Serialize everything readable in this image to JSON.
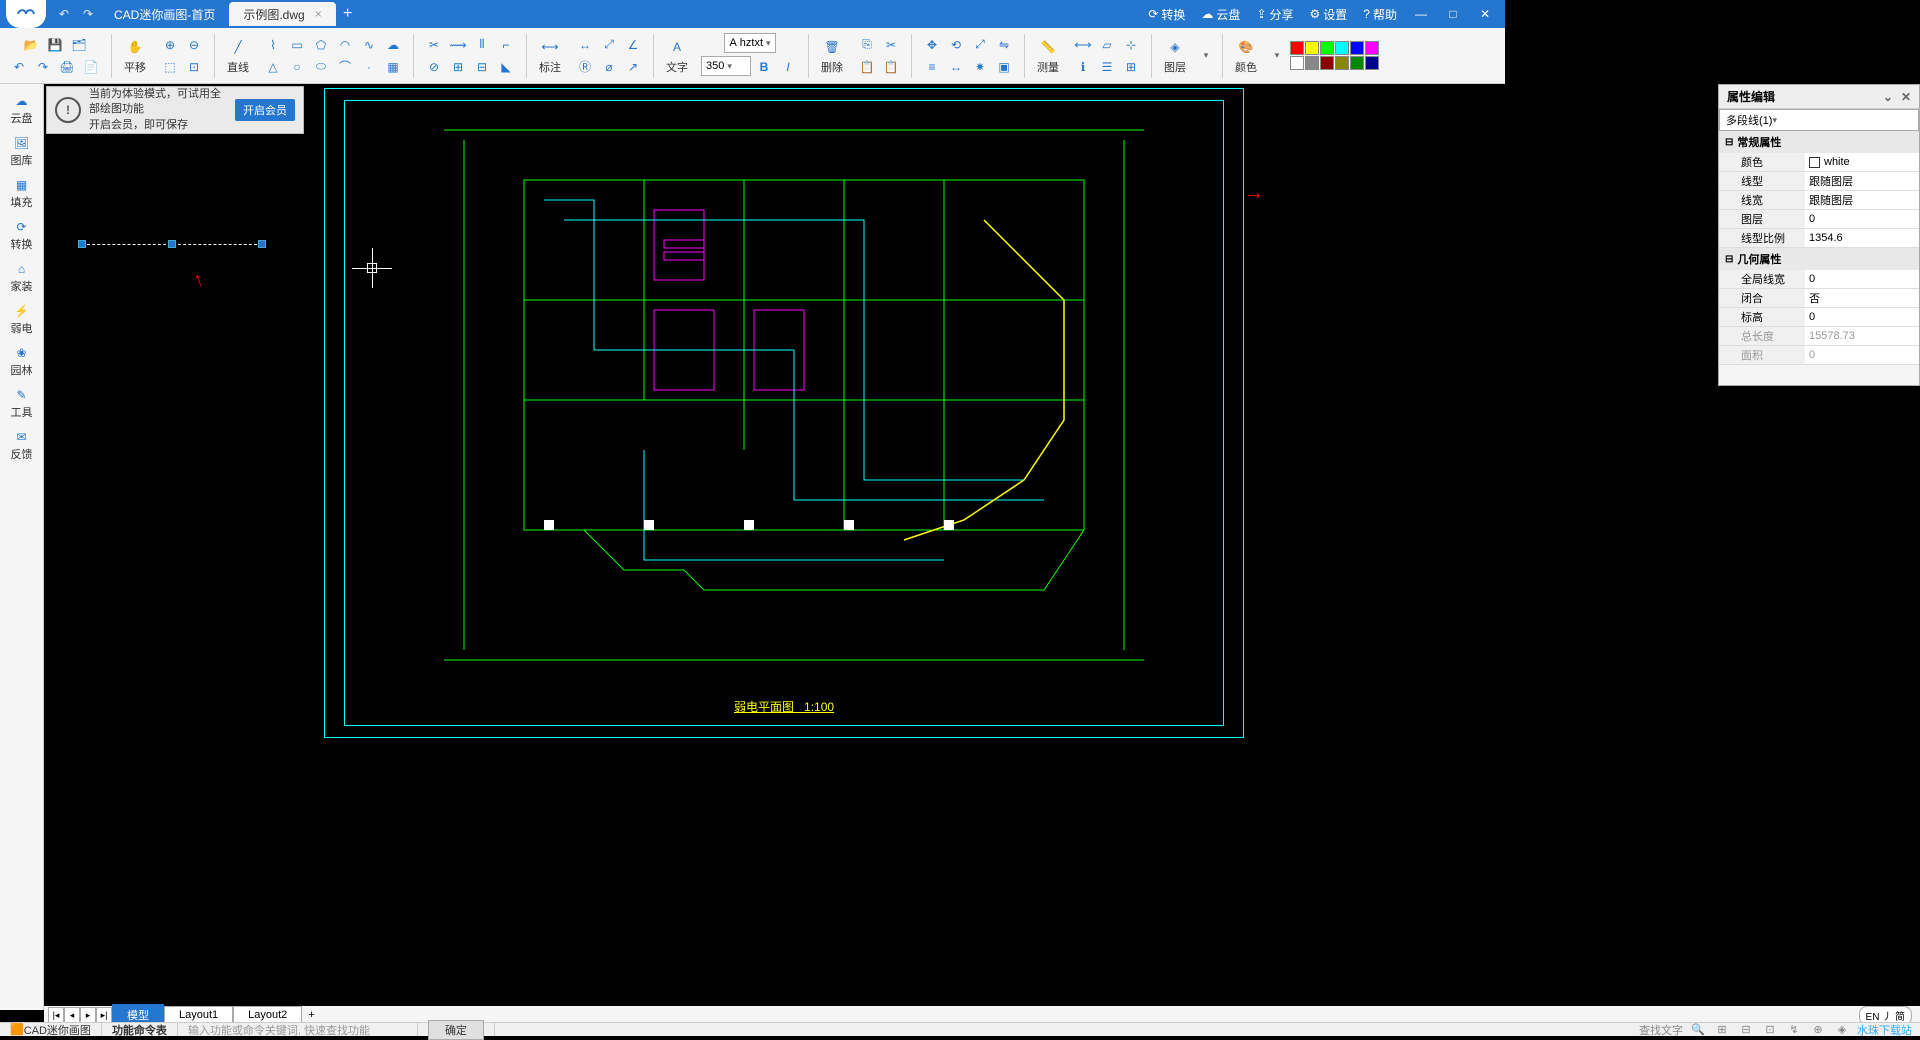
{
  "titlebar": {
    "tabs": [
      {
        "label": "CAD迷你画图-首页",
        "active": false
      },
      {
        "label": "示例图.dwg",
        "active": true
      }
    ],
    "right": {
      "convert": "转换",
      "cloud": "云盘",
      "share": "分享",
      "settings": "设置",
      "help": "帮助"
    }
  },
  "toolbar": {
    "groups": {
      "pan": "平移",
      "line": "直线",
      "annot": "标注",
      "text": "文字",
      "font": "hztxt",
      "size": "350",
      "delete": "删除",
      "measure": "测量",
      "layer": "图层",
      "color": "颜色"
    },
    "palette": [
      "#ff0000",
      "#ffff00",
      "#00ff00",
      "#00ffff",
      "#0000ff",
      "#ff00ff",
      "#ffffff",
      "#808080",
      "#800000",
      "#808000",
      "#008000",
      "#000080"
    ]
  },
  "sidebar": [
    {
      "name": "cloud",
      "label": "云盘"
    },
    {
      "name": "gallery",
      "label": "图库"
    },
    {
      "name": "fill",
      "label": "填充"
    },
    {
      "name": "convert",
      "label": "转换"
    },
    {
      "name": "home",
      "label": "家装"
    },
    {
      "name": "lowvolt",
      "label": "弱电"
    },
    {
      "name": "garden",
      "label": "园林"
    },
    {
      "name": "tools",
      "label": "工具"
    },
    {
      "name": "feedback",
      "label": "反馈"
    }
  ],
  "banner": {
    "line1": "当前为体验模式，可试用全部绘图功能",
    "line2": "开启会员，即可保存",
    "button": "开启会员"
  },
  "properties": {
    "title": "属性编辑",
    "selector": "多段线(1)",
    "sections": {
      "general": "常规属性",
      "geometry": "几何属性"
    },
    "rows": {
      "color_k": "颜色",
      "color_v": "white",
      "ltype_k": "线型",
      "ltype_v": "跟随图层",
      "lweight_k": "线宽",
      "lweight_v": "跟随图层",
      "layer_k": "图层",
      "layer_v": "0",
      "lscale_k": "线型比例",
      "lscale_v": "1354.6",
      "glwidth_k": "全局线宽",
      "glwidth_v": "0",
      "closed_k": "闭合",
      "closed_v": "否",
      "elev_k": "标高",
      "elev_v": "0",
      "length_k": "总长度",
      "length_v": "15578.73",
      "area_k": "面积",
      "area_v": "0"
    }
  },
  "bottom": {
    "tabs": [
      "模型",
      "Layout1",
      "Layout2"
    ],
    "lang": "EN 丿 简"
  },
  "statusbar": {
    "appname": "CAD迷你画图",
    "funcname": "功能命令表",
    "placeholder": "输入功能或命令关键词, 快速查找功能",
    "ok": "确定",
    "findtext": "查找文字",
    "watermark": "水珠下载站"
  },
  "drawing": {
    "title": "弱电平面图",
    "scale": "1:100"
  }
}
